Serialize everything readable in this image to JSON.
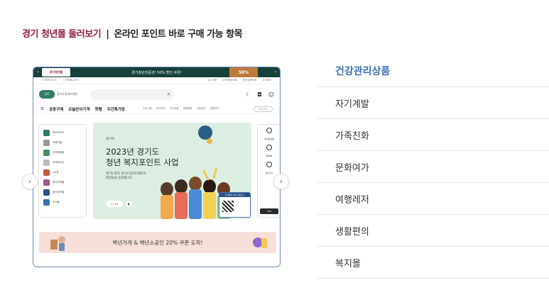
{
  "heading": {
    "accent": "경기 청년몰 둘러보기",
    "separator": "|",
    "rest": "온라인 포인트 바로 구매 가능 항목"
  },
  "preview": {
    "topbar_text": "경기청년전문관! 50% 할인 쿠폰!",
    "sale_badge": "50%",
    "util_left": [
      "★ 북마크추가",
      "☆ 전체메뉴보기"
    ],
    "util_right": [
      "로그아웃",
      "주문/배송조회",
      "찜한상품목록",
      "고객센터"
    ],
    "menu_items": [
      "공동구매",
      "오늘만이가격",
      "핫템",
      "주간특가장"
    ],
    "submenu": [
      "건강식품",
      "뷰티케어",
      "가전제품",
      "생활용품",
      "여행레저",
      "생활편의"
    ],
    "select_text": "지역(전국)",
    "sidebar_items": [
      "복지SHOP",
      "브랜드몰",
      "전국특화몰",
      "지역특산관",
      "e쿠폰",
      "경기지역몰",
      "경기청년몰",
      "도전몰"
    ],
    "banner": {
      "tag": "경기도",
      "title_line1": "2023년 경기도",
      "title_line2": "청년 복지포인트 사업",
      "desc_line1": "경기도청과 경기도일자리재단이",
      "desc_line2": "청년들을 응원합니다.",
      "pager": "1 / 10",
      "qr_head": "경기복지 APP 다운로드"
    },
    "right_items": [
      "최근본상품",
      "찜목록",
      "장바구니"
    ],
    "right_foot": "TOP",
    "coupon_text": "백년가게 & 백년소공인 20% 쿠폰 도착!"
  },
  "categories": [
    {
      "label": "건강관리상품",
      "active": true
    },
    {
      "label": "자기계발",
      "active": false
    },
    {
      "label": "가족친화",
      "active": false
    },
    {
      "label": "문화여가",
      "active": false
    },
    {
      "label": "여행레저",
      "active": false
    },
    {
      "label": "생활편의",
      "active": false
    },
    {
      "label": "복지몰",
      "active": false
    }
  ],
  "colors": {
    "accent": "#8e1f43",
    "active_category": "#3d6fb3",
    "topbar": "#16403b",
    "banner_bg": "#dceee2",
    "coupon_bg": "#f7dfda"
  },
  "icons": {
    "prev": "chevron-left-icon",
    "next": "chevron-right-icon",
    "search": "search-icon"
  }
}
